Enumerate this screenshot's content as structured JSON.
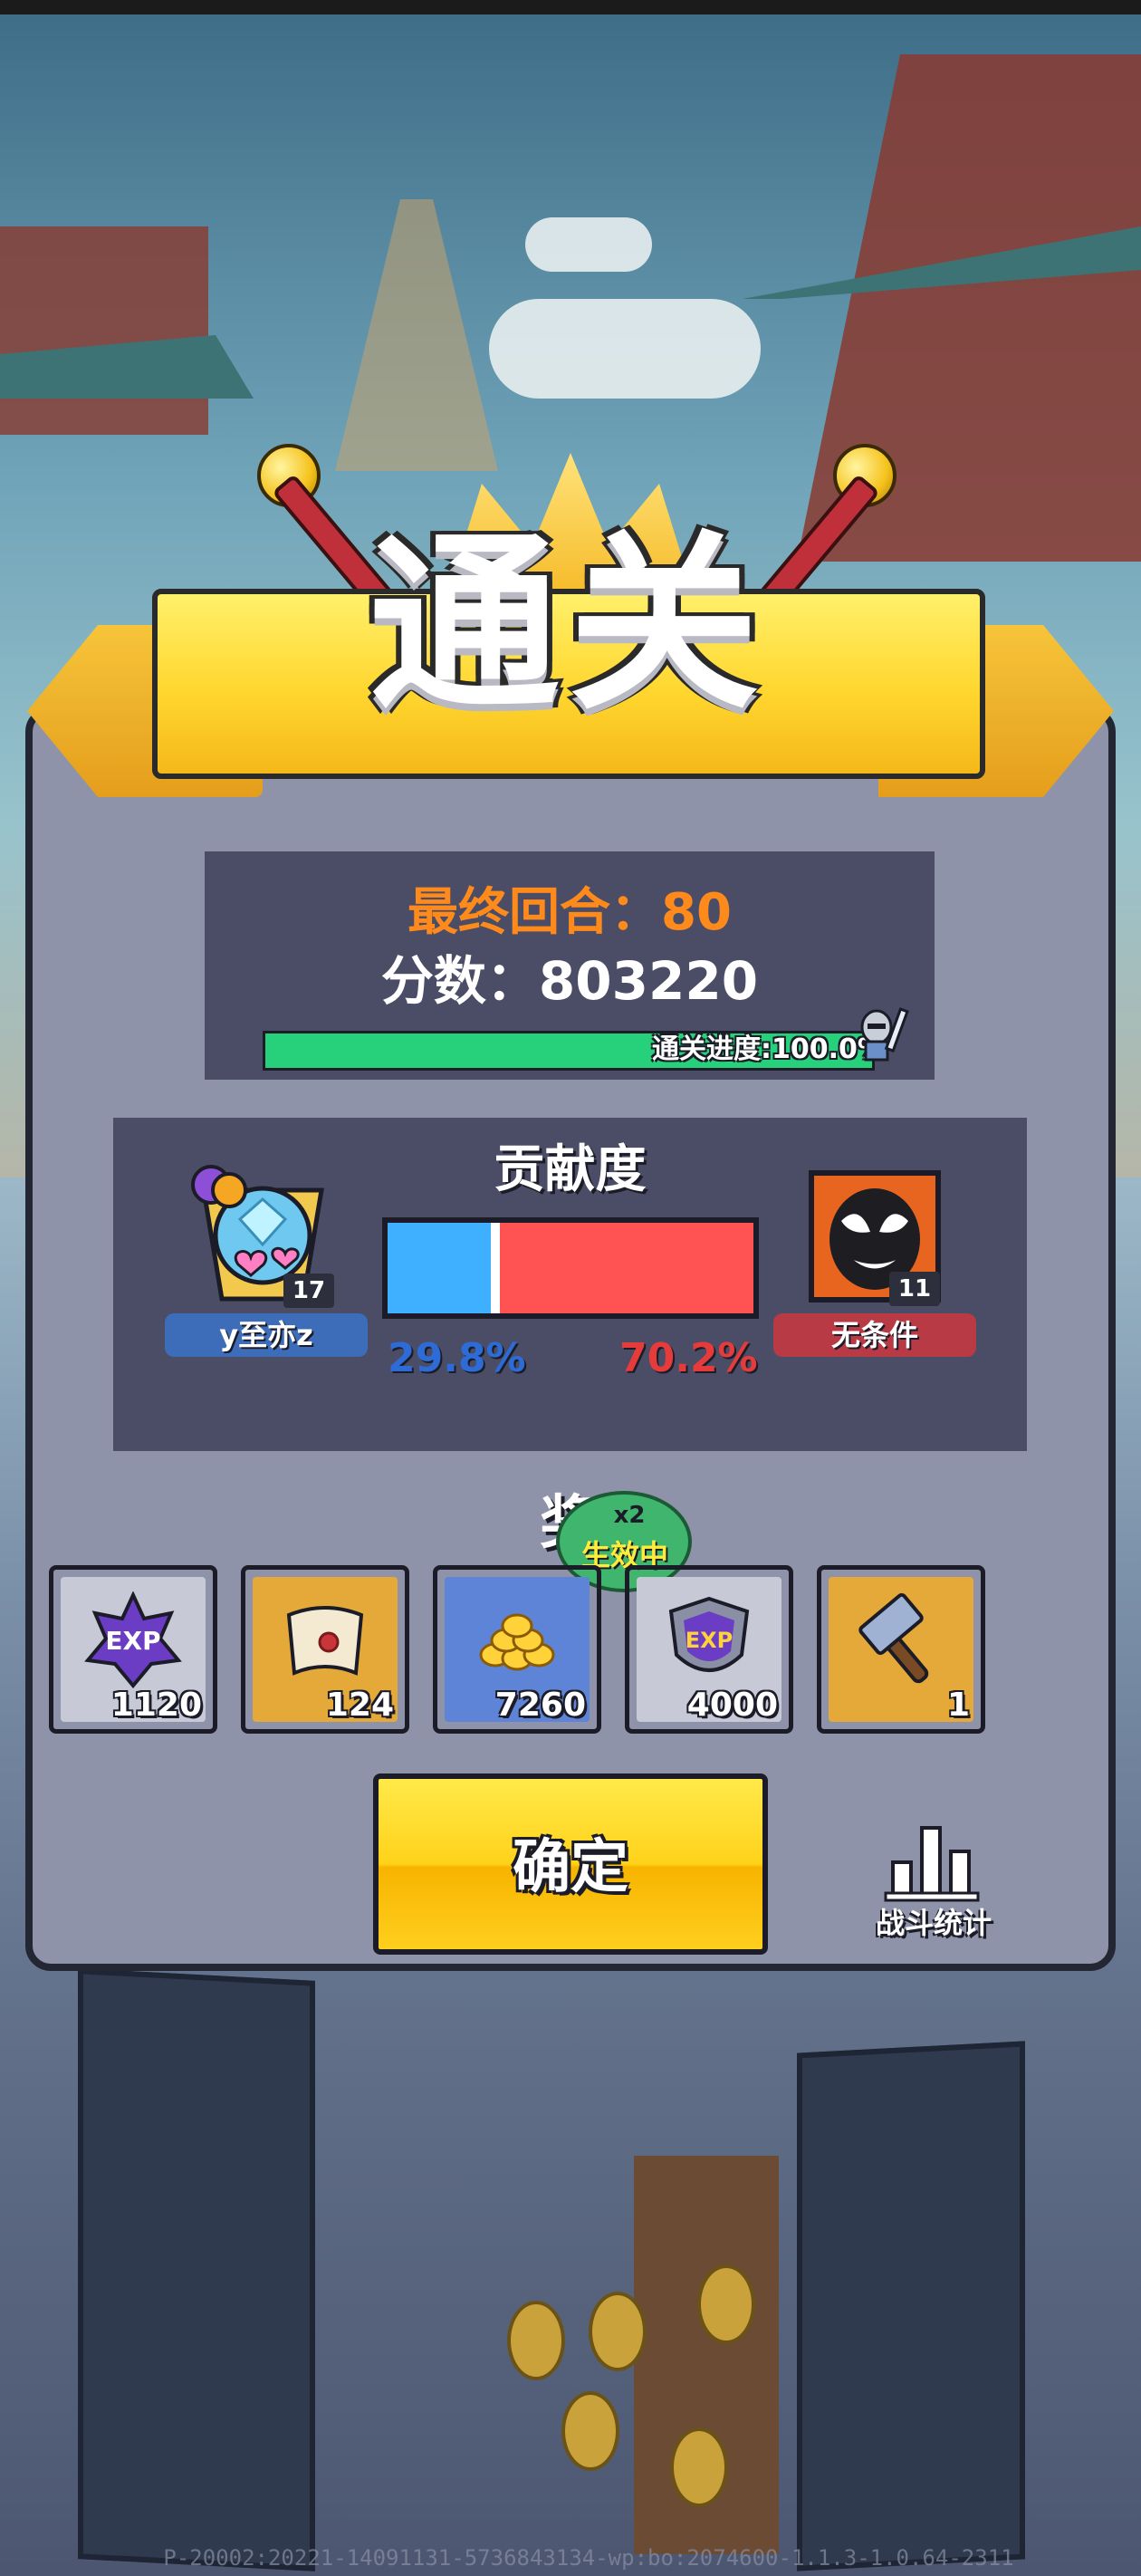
{
  "title": "通关",
  "score_panel": {
    "round_label": "最终回合：80",
    "score_label": "分数：803220",
    "progress_text": "通关进度:100.0%",
    "progress_fraction": 1.0
  },
  "contribution": {
    "title": "贡献度",
    "left_player": {
      "name": "y至亦z",
      "level": "17",
      "percent_text": "29.8%",
      "percent": 29.8
    },
    "right_player": {
      "name": "无条件",
      "level": "11",
      "percent_text": "70.2%",
      "percent": 70.2
    }
  },
  "rewards": {
    "title": "奖励",
    "active_multiplier": "x2",
    "active_label": "生效中",
    "items": [
      {
        "icon": "exp-star-icon",
        "count": "1120"
      },
      {
        "icon": "scroll-icon",
        "count": "124"
      },
      {
        "icon": "gold-coins-icon",
        "count": "7260"
      },
      {
        "icon": "exp-shield-icon",
        "count": "4000"
      },
      {
        "icon": "hammer-icon",
        "count": "1"
      }
    ]
  },
  "buttons": {
    "confirm_label": "确定",
    "stats_label": "战斗统计"
  },
  "footer": "P-20002:20221-14091131-5736843134-wp:bo:2074600-1.1.3-1.0.64-2311",
  "colors": {
    "accent_yellow": "#ffd21a",
    "round_orange": "#ff8a1c",
    "progress_green": "#27d07a",
    "contrib_blue": "#3fb0ff",
    "contrib_red": "#ff5252"
  }
}
